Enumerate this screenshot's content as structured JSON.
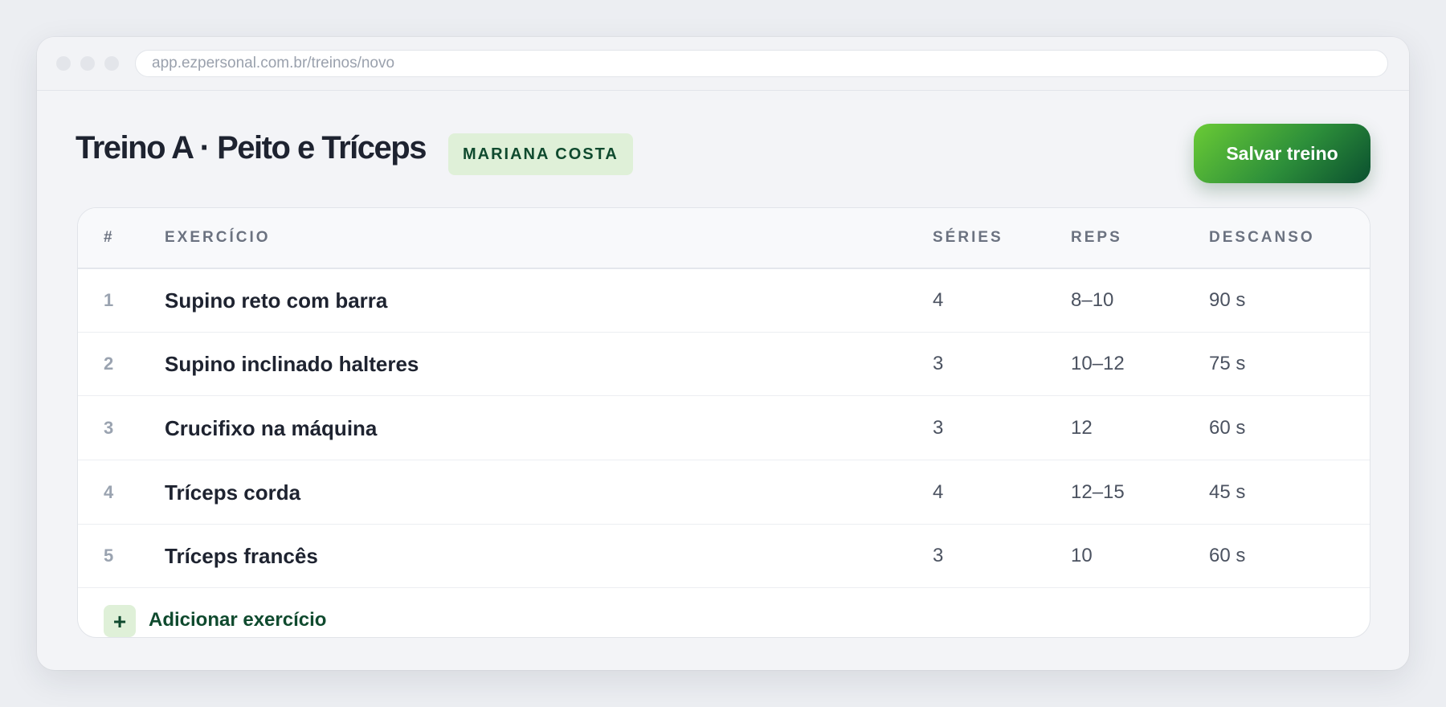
{
  "browser": {
    "url": "app.ezpersonal.com.br/treinos/novo"
  },
  "header": {
    "title": "Treino A · Peito e Tríceps",
    "client_badge": "MARIANA COSTA",
    "save_label": "Salvar treino"
  },
  "table": {
    "columns": {
      "num": "#",
      "exercise": "EXERCÍCIO",
      "series": "SÉRIES",
      "reps": "REPS",
      "rest": "DESCANSO"
    },
    "rows": [
      {
        "num": "1",
        "exercise": "Supino reto com barra",
        "series": "4",
        "reps": "8–10",
        "rest": "90 s"
      },
      {
        "num": "2",
        "exercise": "Supino inclinado halteres",
        "series": "3",
        "reps": "10–12",
        "rest": "75 s"
      },
      {
        "num": "3",
        "exercise": "Crucifixo na máquina",
        "series": "3",
        "reps": "12",
        "rest": "60 s"
      },
      {
        "num": "4",
        "exercise": "Tríceps corda",
        "series": "4",
        "reps": "12–15",
        "rest": "45 s"
      },
      {
        "num": "5",
        "exercise": "Tríceps francês",
        "series": "3",
        "reps": "10",
        "rest": "60 s"
      }
    ],
    "add_label": "Adicionar exercício",
    "add_icon": "+"
  },
  "colors": {
    "accent_dark": "#0f4a2e",
    "accent_light": "#dff0d8",
    "button_gradient_start": "#6acb35",
    "button_gradient_end": "#0a4f2f"
  }
}
